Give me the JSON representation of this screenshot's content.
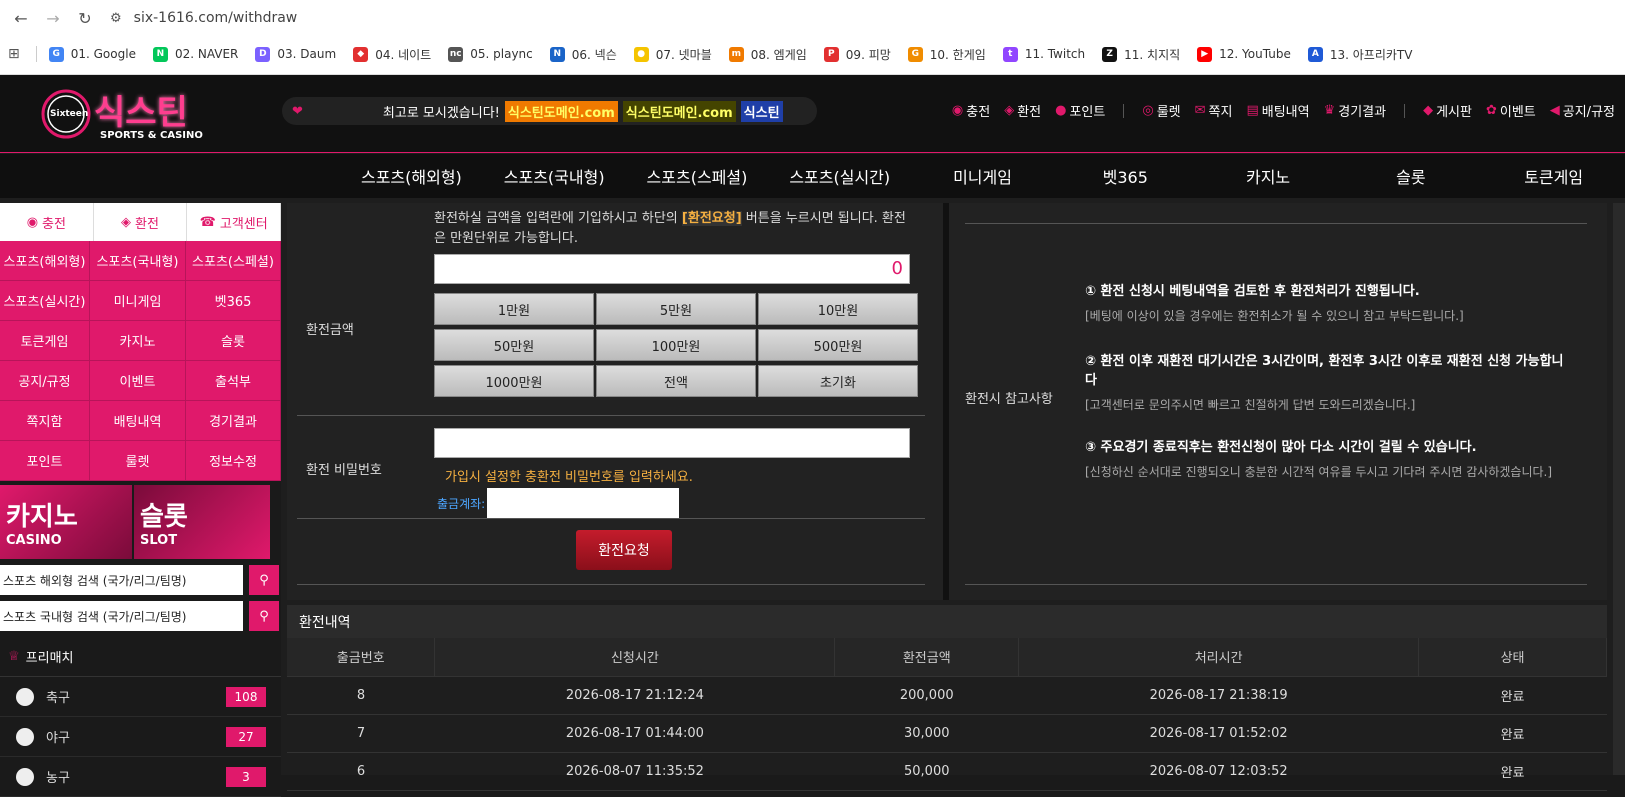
{
  "browser": {
    "url": "six-1616.com/withdraw",
    "bookmarks": [
      {
        "label": "01. Google",
        "color": "#4285f4",
        "glyph": "G"
      },
      {
        "label": "02. NAVER",
        "color": "#03c75a",
        "glyph": "N"
      },
      {
        "label": "03. Daum",
        "color": "#7b61ff",
        "glyph": "D"
      },
      {
        "label": "04. 네이트",
        "color": "#e23030",
        "glyph": "◆"
      },
      {
        "label": "05. plaync",
        "color": "#555555",
        "glyph": "nc"
      },
      {
        "label": "06. 넥슨",
        "color": "#1a64c8",
        "glyph": "N"
      },
      {
        "label": "07. 넷마블",
        "color": "#f5c400",
        "glyph": "●"
      },
      {
        "label": "08. 엠게임",
        "color": "#f07a00",
        "glyph": "m"
      },
      {
        "label": "09. 피망",
        "color": "#e23030",
        "glyph": "P"
      },
      {
        "label": "10. 한게임",
        "color": "#f08c00",
        "glyph": "G"
      },
      {
        "label": "11. Twitch",
        "color": "#9146ff",
        "glyph": "t"
      },
      {
        "label": "11. 치지직",
        "color": "#111111",
        "glyph": "Z"
      },
      {
        "label": "12. YouTube",
        "color": "#ff0000",
        "glyph": "▶"
      },
      {
        "label": "13. 아프리카TV",
        "color": "#1f5ad6",
        "glyph": "A"
      }
    ]
  },
  "header": {
    "logo_text": "식스틴",
    "logo_sub": "SPORTS & CASINO",
    "logo_badge": "Sixteen",
    "marquee_text": "최고로 모시겠습니다!",
    "marquee_tags": [
      {
        "text": "식스틴도메인.com",
        "bg": "#f07a00",
        "fg": "#ffff66"
      },
      {
        "text": "식스틴도메인.com",
        "bg": "#444400",
        "fg": "#ffff66"
      },
      {
        "text": "식스틴",
        "bg": "#1f3fa8",
        "fg": "#ffffff"
      }
    ],
    "top_menu_a": [
      "충전",
      "환전",
      "포인트"
    ],
    "top_menu_b": [
      "룰렛",
      "쪽지",
      "배팅내역",
      "경기결과"
    ],
    "top_menu_c": [
      "게시판",
      "이벤트",
      "공지/규정"
    ]
  },
  "main_nav": [
    "스포츠(해외형)",
    "스포츠(국내형)",
    "스포츠(스페셜)",
    "스포츠(실시간)",
    "미니게임",
    "벳365",
    "카지노",
    "슬롯",
    "토큰게임"
  ],
  "sidebar": {
    "top": [
      "충전",
      "환전",
      "고객센터"
    ],
    "grid": [
      "스포츠(해외형)",
      "스포츠(국내형)",
      "스포츠(스페셜)",
      "스포츠(실시간)",
      "미니게임",
      "벳365",
      "토큰게임",
      "카지노",
      "슬롯",
      "공지/규정",
      "이벤트",
      "출석부",
      "쪽지함",
      "배팅내역",
      "경기결과",
      "포인트",
      "룰렛",
      "정보수정"
    ],
    "banner_casino": {
      "ko": "카지노",
      "en": "CASINO"
    },
    "banner_slot": {
      "ko": "슬롯",
      "en": "SLOT"
    },
    "search1": "스포츠 해외형 검색 (국가/리그/팀명)",
    "search2": "스포츠 국내형 검색 (국가/리그/팀명)",
    "prematch": "프리매치",
    "sports": [
      {
        "name": "축구",
        "count": "108"
      },
      {
        "name": "야구",
        "count": "27"
      },
      {
        "name": "농구",
        "count": "3"
      }
    ]
  },
  "withdraw": {
    "notice_pre": "환전하실 금액을 입력란에 기입하시고 하단의",
    "notice_hl": "[환전요청]",
    "notice_post": "버튼을 누르시면 됩니다. 환전은 만원단위로 가능합니다.",
    "amount_label": "환전금액",
    "amount_value": "0",
    "amount_buttons": [
      "1만원",
      "5만원",
      "10만원",
      "50만원",
      "100만원",
      "500만원",
      "1000만원",
      "전액",
      "초기화"
    ],
    "password_label": "환전 비밀번호",
    "password_help": "가입시 설정한 충환전 비밀번호를 입력하세요.",
    "account_label": "출금계좌:",
    "submit_label": "환전요청"
  },
  "info": {
    "title": "환전시 참고사항",
    "items": [
      {
        "h": "① 환전 신청시 베팅내역을 검토한 후 환전처리가 진행됩니다.",
        "s": "[베팅에 이상이 있을 경우에는 환전취소가 될 수 있으니 참고 부탁드립니다.]"
      },
      {
        "h": "② 환전 이후 재환전 대기시간은 3시간이며, 환전후 3시간 이후로 재환전 신청 가능합니다",
        "s": "[고객센터로 문의주시면 빠르고 친절하게 답변 도와드리겠습니다.]"
      },
      {
        "h": "③ 주요경기 종료직후는 환전신청이 많아 다소 시간이 걸릴 수 있습니다.",
        "s": "[신청하신 순서대로 진행되오니 충분한 시간적 여유를 두시고 기다려 주시면 감사하겠습니다.]"
      }
    ]
  },
  "history": {
    "title": "환전내역",
    "columns": [
      "출금번호",
      "신청시간",
      "환전금액",
      "처리시간",
      "상태"
    ],
    "rows": [
      [
        "8",
        "2026-08-17 21:12:24",
        "200,000",
        "2026-08-17 21:38:19",
        "완료"
      ],
      [
        "7",
        "2026-08-17 01:44:00",
        "30,000",
        "2026-08-17 01:52:02",
        "완료"
      ],
      [
        "6",
        "2026-08-07 11:35:52",
        "50,000",
        "2026-08-07 12:03:52",
        "완료"
      ]
    ]
  }
}
